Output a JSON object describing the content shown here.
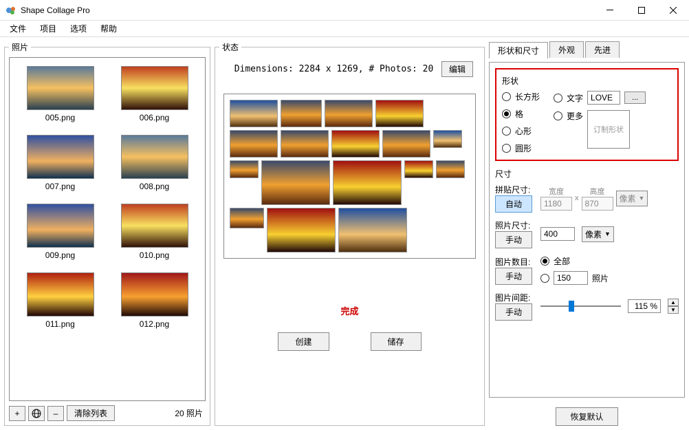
{
  "window": {
    "title": "Shape Collage Pro"
  },
  "menubar": {
    "file": "文件",
    "project": "项目",
    "options": "选项",
    "help": "帮助"
  },
  "panels": {
    "photos": {
      "legend": "照片",
      "items": [
        {
          "name": "005.png"
        },
        {
          "name": "006.png"
        },
        {
          "name": "007.png"
        },
        {
          "name": "008.png"
        },
        {
          "name": "009.png"
        },
        {
          "name": "010.png"
        },
        {
          "name": "011.png"
        },
        {
          "name": "012.png"
        }
      ],
      "clear_list": "清除列表",
      "count_text": "20 照片"
    },
    "status": {
      "legend": "状态",
      "dimensions_text": "Dimensions: 2284 x 1269, # Photos: 20",
      "edit": "编辑",
      "done": "完成",
      "create": "创建",
      "save": "储存"
    }
  },
  "tabs": {
    "shape_size": "形状和尺寸",
    "appearance": "外观",
    "advanced": "先进"
  },
  "shape": {
    "title": "形状",
    "rect": "长方形",
    "grid": "格",
    "heart": "心形",
    "circle": "圆形",
    "text": "文字",
    "more": "更多",
    "text_value": "LOVE",
    "ellipsis": "...",
    "custom_placeholder": "订制形状",
    "selected": "grid"
  },
  "size": {
    "title": "尺寸",
    "collage_size_label": "拼贴尺寸:",
    "auto": "自动",
    "manual": "手动",
    "width_label": "宽度",
    "height_label": "高度",
    "width_value": "1180",
    "height_value": "870",
    "x": "x",
    "pixels_unit": "像素",
    "photo_size_label": "照片尺寸:",
    "photo_size_value": "400",
    "photo_count_label": "图片数目:",
    "all": "全部",
    "count_value": "150",
    "photos_suffix": "照片",
    "spacing_label": "图片间距:",
    "spacing_value": "115 %"
  },
  "restore_defaults": "恢复默认"
}
